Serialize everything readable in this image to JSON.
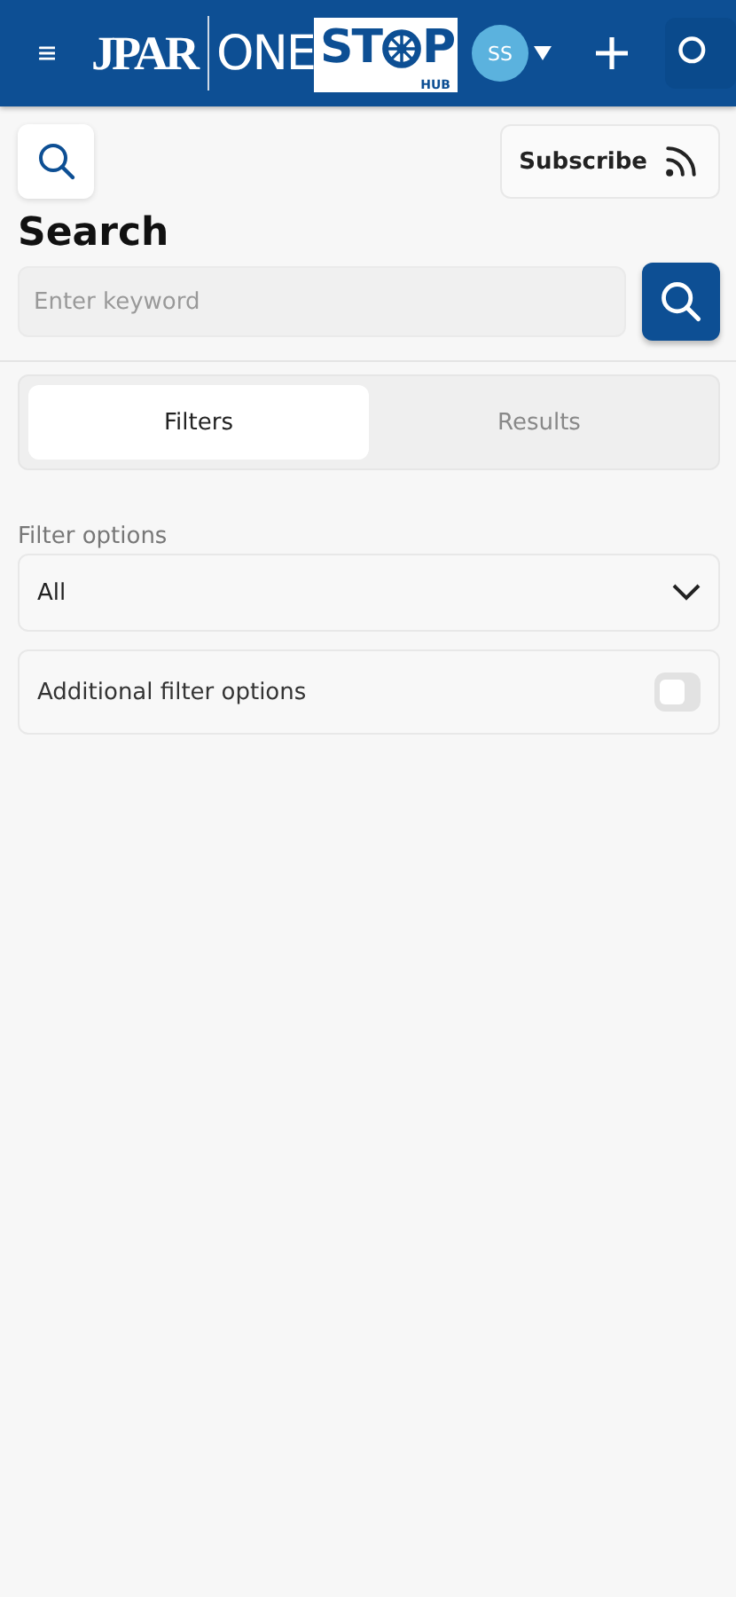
{
  "header": {
    "logo": {
      "brand": "JPAR",
      "one": "ONE",
      "stop_start": "ST",
      "stop_end": "P",
      "hub": "HUB"
    },
    "avatar": "SS"
  },
  "toolbar": {
    "subscribe": "Subscribe"
  },
  "title": "Search",
  "search": {
    "placeholder": "Enter keyword"
  },
  "tabs": [
    {
      "label": "Filters",
      "selected": true
    },
    {
      "label": "Results",
      "selected": false
    }
  ],
  "filter": {
    "label": "Filter options",
    "value": "All"
  },
  "toggle": {
    "label": "Additional filter options",
    "checked": false
  }
}
